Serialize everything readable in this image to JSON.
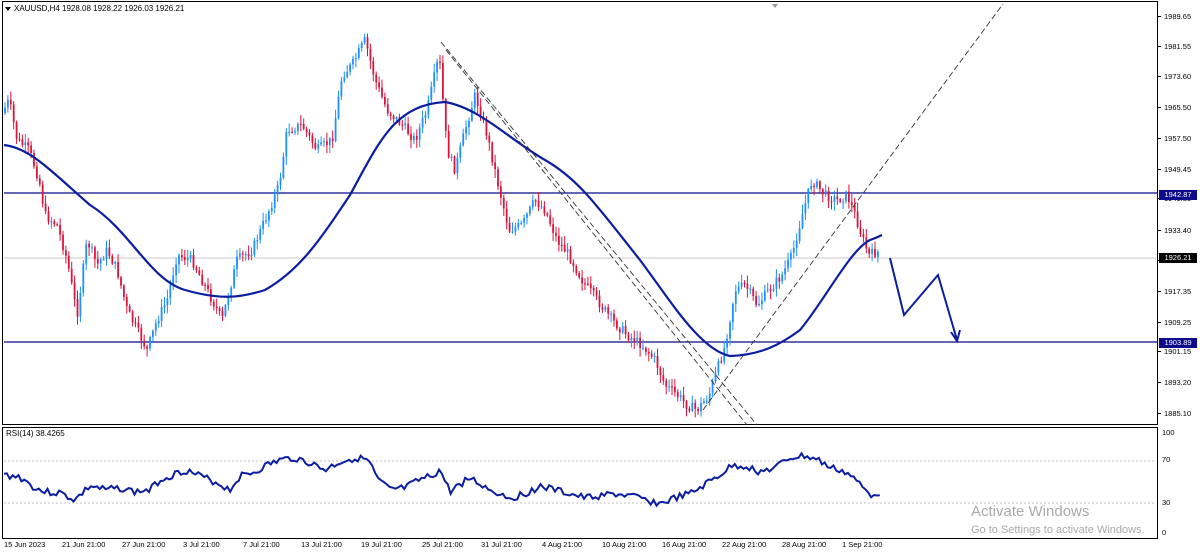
{
  "chart": {
    "symbol_label": "XAUUSD,H4  1928.08 1928.22 1926.03 1926.21",
    "current_price": "1926.21",
    "price_axis": [
      "1989.65",
      "1981.55",
      "1973.60",
      "1965.50",
      "1957.50",
      "1949.45",
      "1941.35",
      "1933.40",
      "1925.30",
      "1917.35",
      "1909.25",
      "1901.15",
      "1893.20",
      "1885.10"
    ],
    "levels": {
      "upper": "1942.87",
      "lower": "1903.89"
    },
    "time_axis": [
      "15 Jun 2023",
      "21 Jun 21:00",
      "27 Jun 21:00",
      "3 Jul 21:00",
      "7 Jul 21:00",
      "13 Jul 21:00",
      "19 Jul 21:00",
      "25 Jul 21:00",
      "31 Jul 21:00",
      "4 Aug 21:00",
      "10 Aug 21:00",
      "16 Aug 21:00",
      "22 Aug 21:00",
      "28 Aug 21:00",
      "1 Sep 21:00"
    ],
    "colors": {
      "bull": "#1e90ff",
      "bear": "#dc143c",
      "ma": "#0b1ea0",
      "level": "#0b0b8c"
    }
  },
  "rsi": {
    "label": "RSI(14) 38.4265",
    "axis": [
      "100",
      "70",
      "30",
      "0"
    ]
  },
  "watermark": {
    "title": "Activate Windows",
    "subtitle": "Go to Settings to activate Windows."
  }
}
